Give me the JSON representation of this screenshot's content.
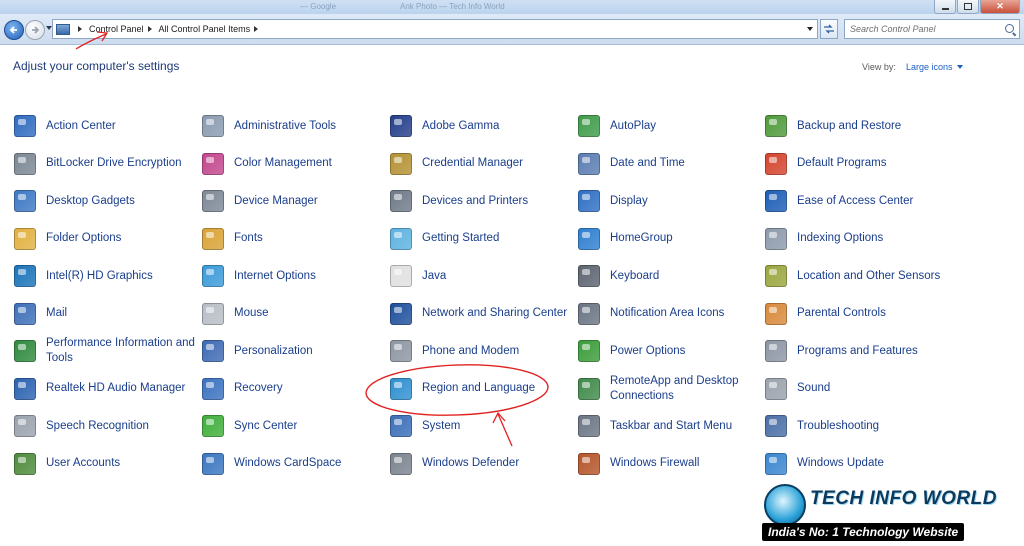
{
  "window": {
    "ghost_tabs": [
      "— Google",
      "Ank Photo — Tech Info World"
    ]
  },
  "address": {
    "crumbs": [
      "Control Panel",
      "All Control Panel Items"
    ],
    "search_placeholder": "Search Control Panel"
  },
  "header": {
    "title": "Adjust your computer's settings",
    "view_by_label": "View by:",
    "view_by_value": "Large icons"
  },
  "items": [
    {
      "label": "Action Center",
      "icon": "flag-icon",
      "color": "#2f6bbf"
    },
    {
      "label": "Administrative Tools",
      "icon": "tools-icon",
      "color": "#8a9bb0"
    },
    {
      "label": "Adobe Gamma",
      "icon": "monitor-icon",
      "color": "#243e8a"
    },
    {
      "label": "AutoPlay",
      "icon": "autoplay-icon",
      "color": "#3e9b4a"
    },
    {
      "label": "Backup and Restore",
      "icon": "backup-icon",
      "color": "#4e9a3a"
    },
    {
      "label": "BitLocker Drive Encryption",
      "icon": "bitlocker-icon",
      "color": "#7b8794"
    },
    {
      "label": "Color Management",
      "icon": "color-icon",
      "color": "#c2478d"
    },
    {
      "label": "Credential Manager",
      "icon": "vault-icon",
      "color": "#b49233"
    },
    {
      "label": "Date and Time",
      "icon": "clock-icon",
      "color": "#5a7db2"
    },
    {
      "label": "Default Programs",
      "icon": "default-programs-icon",
      "color": "#d3442e"
    },
    {
      "label": "Desktop Gadgets",
      "icon": "gadgets-icon",
      "color": "#3d78c4"
    },
    {
      "label": "Device Manager",
      "icon": "device-manager-icon",
      "color": "#7d8896"
    },
    {
      "label": "Devices and Printers",
      "icon": "printer-icon",
      "color": "#6f7a88"
    },
    {
      "label": "Display",
      "icon": "display-icon",
      "color": "#2e6fc4"
    },
    {
      "label": "Ease of Access Center",
      "icon": "ease-access-icon",
      "color": "#1d5db5"
    },
    {
      "label": "Folder Options",
      "icon": "folder-icon",
      "color": "#e2b040"
    },
    {
      "label": "Fonts",
      "icon": "fonts-icon",
      "color": "#d9a235"
    },
    {
      "label": "Getting Started",
      "icon": "getting-started-icon",
      "color": "#5db2e0"
    },
    {
      "label": "HomeGroup",
      "icon": "homegroup-icon",
      "color": "#2f7fd0"
    },
    {
      "label": "Indexing Options",
      "icon": "indexing-icon",
      "color": "#8c9aab"
    },
    {
      "label": "Intel(R) HD Graphics",
      "icon": "intel-graphics-icon",
      "color": "#1a73b9"
    },
    {
      "label": "Internet Options",
      "icon": "internet-icon",
      "color": "#3a9ad8"
    },
    {
      "label": "Java",
      "icon": "java-icon",
      "color": "#e0e0e0"
    },
    {
      "label": "Keyboard",
      "icon": "keyboard-icon",
      "color": "#5c6470"
    },
    {
      "label": "Location and Other Sensors",
      "icon": "sensors-icon",
      "color": "#9aa63e"
    },
    {
      "label": "Mail",
      "icon": "mail-icon",
      "color": "#3c6fb8"
    },
    {
      "label": "Mouse",
      "icon": "mouse-icon",
      "color": "#b8bec6"
    },
    {
      "label": "Network and Sharing Center",
      "icon": "network-icon",
      "color": "#1e4f9c"
    },
    {
      "label": "Notification Area Icons",
      "icon": "notification-icon",
      "color": "#6a7482"
    },
    {
      "label": "Parental Controls",
      "icon": "parental-icon",
      "color": "#d8893a"
    },
    {
      "label": "Performance Information and Tools",
      "icon": "performance-icon",
      "color": "#2f8a3e"
    },
    {
      "label": "Personalization",
      "icon": "personalization-icon",
      "color": "#3e6ab4"
    },
    {
      "label": "Phone and Modem",
      "icon": "phone-icon",
      "color": "#8d96a2"
    },
    {
      "label": "Power Options",
      "icon": "power-icon",
      "color": "#3b9c3a"
    },
    {
      "label": "Programs and Features",
      "icon": "programs-icon",
      "color": "#8c96a4"
    },
    {
      "label": "Realtek HD Audio Manager",
      "icon": "audio-manager-icon",
      "color": "#2b62b0"
    },
    {
      "label": "Recovery",
      "icon": "recovery-icon",
      "color": "#3b72c0"
    },
    {
      "label": "Region and Language",
      "icon": "globe-icon",
      "color": "#2f8fd0"
    },
    {
      "label": "RemoteApp and Desktop Connections",
      "icon": "remoteapp-icon",
      "color": "#3f8a4a"
    },
    {
      "label": "Sound",
      "icon": "sound-icon",
      "color": "#9aa2ad"
    },
    {
      "label": "Speech Recognition",
      "icon": "microphone-icon",
      "color": "#9aa2ad"
    },
    {
      "label": "Sync Center",
      "icon": "sync-icon",
      "color": "#3fae3a"
    },
    {
      "label": "System",
      "icon": "system-icon",
      "color": "#3a6eb8"
    },
    {
      "label": "Taskbar and Start Menu",
      "icon": "taskbar-icon",
      "color": "#6b7583"
    },
    {
      "label": "Troubleshooting",
      "icon": "troubleshooting-icon",
      "color": "#4a6ea6"
    },
    {
      "label": "User Accounts",
      "icon": "users-icon",
      "color": "#4d8a3c"
    },
    {
      "label": "Windows CardSpace",
      "icon": "cardspace-icon",
      "color": "#3a76c0"
    },
    {
      "label": "Windows Defender",
      "icon": "defender-icon",
      "color": "#7b838e"
    },
    {
      "label": "Windows Firewall",
      "icon": "firewall-icon",
      "color": "#b5542a"
    },
    {
      "label": "Windows Update",
      "icon": "update-icon",
      "color": "#3a86cf"
    }
  ],
  "watermark": {
    "name": "TECH INFO WORLD",
    "tagline": "India's No: 1 Technology Website"
  }
}
